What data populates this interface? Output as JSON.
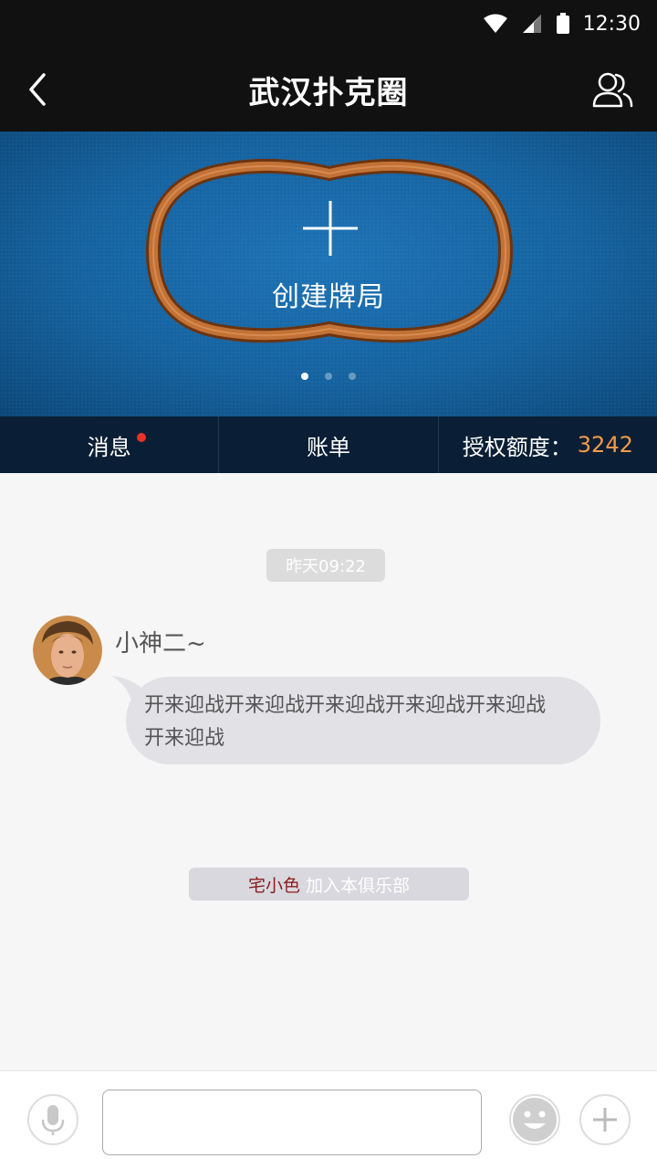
{
  "status_bar": {
    "time": "12:30"
  },
  "header": {
    "title": "武汉扑克圈"
  },
  "banner": {
    "create_label": "创建牌局",
    "slides": 3,
    "active_slide": 1
  },
  "tabs": {
    "messages": "消息",
    "bill": "账单",
    "quota_label": "授权额度：",
    "quota_value": "3242"
  },
  "chat": {
    "timestamp": "昨天09:22",
    "message": {
      "sender": "小神二~",
      "line1": "开来迎战开来迎战开来迎战开来迎战开来迎战",
      "line2": "开来迎战"
    },
    "join_notice": {
      "name": "宅小色",
      "action": "加入本俱乐部"
    }
  },
  "input": {
    "placeholder": ""
  },
  "colors": {
    "header_bg": "#111111",
    "banner_blue": "#15629f",
    "tab_bg": "#0a1f35",
    "quota": "#f49a4a",
    "unread_dot": "#e8332a"
  }
}
